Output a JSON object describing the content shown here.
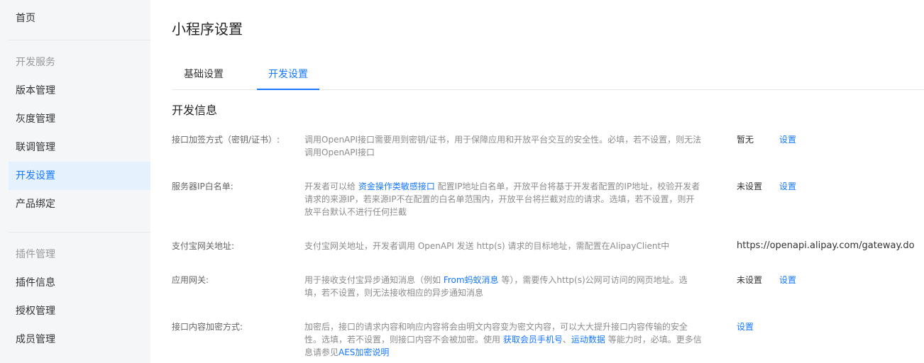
{
  "sidebar": {
    "home": "首页",
    "group_dev": "开发服务",
    "dev_items": [
      "版本管理",
      "灰度管理",
      "联调管理",
      "开发设置",
      "产品绑定"
    ],
    "group_plugin": "插件管理",
    "plugin_items": [
      "插件信息",
      "授权管理",
      "成员管理"
    ],
    "active_item": "开发设置"
  },
  "main": {
    "page_title": "小程序设置",
    "tabs": [
      {
        "label": "基础设置",
        "active": false
      },
      {
        "label": "开发设置",
        "active": true
      }
    ],
    "section_title": "开发信息",
    "rows": [
      {
        "label": "接口加签方式（密钥/证书）:",
        "desc": "调用OpenAPI接口需要用到密钥/证书，用于保障应用和开放平台交互的安全性。必填，若不设置，则无法调用OpenAPI接口",
        "value": "暂无",
        "action": "设置"
      },
      {
        "label": "服务器IP白名单:",
        "desc_pre": "开发者可以给 ",
        "desc_link": "资金操作类敏感接口",
        "desc_post": " 配置IP地址白名单，开放平台将基于开发者配置的IP地址，校验开发者请求的来源IP，若来源IP不在配置的白名单范围内，开放平台将拦截对应的请求。选填，若不设置，则开放平台默认不进行任何拦截",
        "value": "未设置",
        "action": "设置"
      },
      {
        "label": "支付宝网关地址:",
        "desc": "支付宝网关地址，开发者调用 OpenAPI 发送 http(s) 请求的目标地址，需配置在AlipayClient中",
        "value": "https://openapi.alipay.com/gateway.do"
      },
      {
        "label": "应用网关:",
        "desc_pre": "用于接收支付宝异步通知消息（例如 ",
        "desc_link": "From蚂蚁消息",
        "desc_post": " 等），需要传入http(s)公网可访问的网页地址。选填，若不设置，则无法接收相应的异步通知消息",
        "value": "未设置",
        "action": "设置"
      },
      {
        "label": "接口内容加密方式:",
        "desc_pre": "加密后，接口的请求内容和响应内容将会由明文内容变为密文内容，可以大大提升接口内容传输的安全性。选填，若不设置，则接口内容不会被加密。使用 ",
        "desc_link1": "获取会员手机号",
        "desc_sep": "、",
        "desc_link2": "运动数据",
        "desc_mid": " 等能力时，必填。更多信息请参见",
        "desc_link3": "AES加密说明",
        "action": "设置"
      }
    ]
  },
  "colors": {
    "accent": "#1677ff",
    "sidebar_bg": "#f5f6f8",
    "active_bg": "#e5f1fd"
  }
}
